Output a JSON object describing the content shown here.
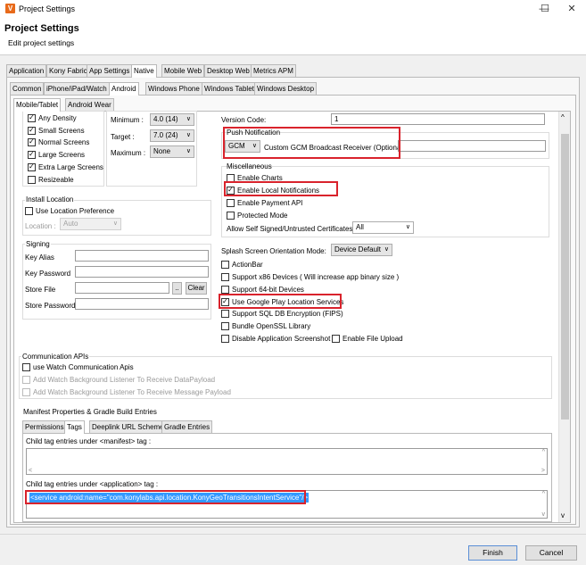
{
  "window": {
    "title": "Project Settings",
    "minimize": "—",
    "maximize": "☐",
    "close": "✕",
    "app_icon": "V"
  },
  "header": {
    "title": "Project Settings",
    "subtitle": "Edit project settings"
  },
  "top_tabs": [
    "Application",
    "Kony Fabric",
    "App Settings",
    "Native",
    "Mobile Web",
    "Desktop Web",
    "Metrics APM"
  ],
  "platform_tabs": [
    "Common",
    "iPhone/iPad/Watch",
    "Android",
    "Windows Phone",
    "Windows Tablet",
    "Windows Desktop"
  ],
  "device_tabs": [
    "Mobile/Tablet",
    "Android Wear"
  ],
  "screens": {
    "items": [
      {
        "label": "Any Density",
        "checked": true
      },
      {
        "label": "Small Screens",
        "checked": true
      },
      {
        "label": "Normal Screens",
        "checked": true
      },
      {
        "label": "Large Screens",
        "checked": true
      },
      {
        "label": "Extra Large Screens",
        "checked": true
      },
      {
        "label": "Resizeable",
        "checked": false
      }
    ]
  },
  "sdk": {
    "minimum_label": "Minimum :",
    "minimum_value": "4.0 (14)",
    "target_label": "Target :",
    "target_value": "7.0 (24)",
    "maximum_label": "Maximum :",
    "maximum_value": "None"
  },
  "version": {
    "label": "Version Code:",
    "value": "1"
  },
  "push": {
    "group": "Push Notification",
    "select": "GCM",
    "receiver_label": "Custom GCM Broadcast Receiver (Optional)",
    "receiver_value": ""
  },
  "misc": {
    "group": "Miscellaneous",
    "items": [
      {
        "label": "Enable Charts",
        "checked": false
      },
      {
        "label": "Enable Local Notifications",
        "checked": true
      },
      {
        "label": "Enable Payment API",
        "checked": false
      },
      {
        "label": "Protected Mode",
        "checked": false
      }
    ],
    "self_signed_label": "Allow Self Signed/Untrusted Certificates",
    "self_signed_value": "All"
  },
  "install": {
    "group": "Install Location",
    "use_pref": "Use Location Preference",
    "location_label": "Location :",
    "location_value": "Auto"
  },
  "signing": {
    "group": "Signing",
    "key_alias": "Key Alias",
    "key_password": "Key Password",
    "store_file": "Store File",
    "browse": "..",
    "clear": "Clear",
    "store_password": "Store Password"
  },
  "splash": {
    "label": "Splash Screen Orientation Mode:",
    "value": "Device Default"
  },
  "options": [
    {
      "label": "ActionBar",
      "checked": false
    },
    {
      "label": "Support x86 Devices   ( Will increase app binary size )",
      "checked": false
    },
    {
      "label": "Support 64-bit Devices",
      "checked": false
    },
    {
      "label": "Use Google Play Location Services",
      "checked": true
    },
    {
      "label": "Support SQL DB Encryption (FIPS)",
      "checked": false
    },
    {
      "label": "Bundle OpenSSL Library",
      "checked": false
    },
    {
      "label": "Disable Application Screenshot",
      "checked": false
    }
  ],
  "file_upload": {
    "label": "Enable File Upload",
    "checked": false
  },
  "comm": {
    "group": "Communication APIs",
    "watch": "use Watch Communication Apis",
    "listener_data": "Add Watch Background Listener To Receive DataPayload",
    "listener_msg": "Add Watch Background Listener To Receive Message Payload"
  },
  "manifest": {
    "group": "Manifest Properties & Gradle Build Entries",
    "tabs": [
      "Permissions",
      "Tags",
      "Deeplink URL Scheme",
      "Gradle Entries"
    ],
    "manifest_label": "Child tag entries under <manifest> tag :",
    "application_label": "Child tag entries under <application> tag :",
    "application_value": "<service android:name=\"com.konylabs.api.location.KonyGeoTransitionsIntentService\"/>"
  },
  "footer": {
    "finish": "Finish",
    "cancel": "Cancel"
  },
  "colors": {
    "highlight_red": "#d9232c",
    "selection_blue": "#3399ff",
    "app_orange": "#e86a1a"
  }
}
